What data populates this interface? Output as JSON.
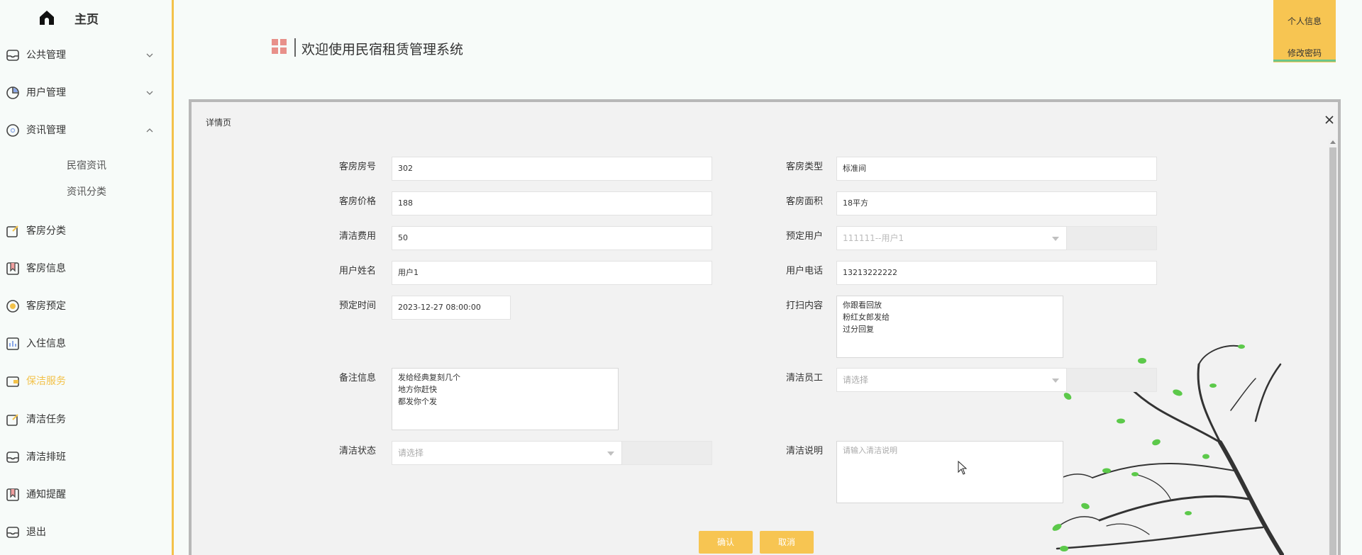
{
  "sidebar": {
    "home_label": "主页",
    "items": [
      {
        "label": "公共管理",
        "icon": "inbox-icon",
        "expandable": true,
        "expanded": false
      },
      {
        "label": "用户管理",
        "icon": "pie-chart-icon",
        "expandable": true,
        "expanded": false
      },
      {
        "label": "资讯管理",
        "icon": "compass-icon",
        "expandable": true,
        "expanded": true
      },
      {
        "label": "客房分类",
        "icon": "edit-icon"
      },
      {
        "label": "客房信息",
        "icon": "bookmark-icon"
      },
      {
        "label": "客房预定",
        "icon": "coin-icon"
      },
      {
        "label": "入住信息",
        "icon": "bar-chart-icon"
      },
      {
        "label": "保洁服务",
        "icon": "wallet-icon",
        "active": true
      },
      {
        "label": "清洁任务",
        "icon": "edit-icon"
      },
      {
        "label": "清洁排班",
        "icon": "inbox-icon"
      },
      {
        "label": "通知提醒",
        "icon": "bookmark-icon"
      },
      {
        "label": "退出",
        "icon": "inbox-icon"
      }
    ],
    "subitems": [
      "民宿资讯",
      "资讯分类"
    ]
  },
  "header": {
    "title": "欢迎使用民宿租赁管理系统",
    "user_info": "个人信息",
    "change_password": "修改密码"
  },
  "dialog": {
    "title": "详情页",
    "fields": {
      "room_no": {
        "label": "客房房号",
        "value": "302"
      },
      "room_type": {
        "label": "客房类型",
        "value": "标准间"
      },
      "room_price": {
        "label": "客房价格",
        "value": "188"
      },
      "room_area": {
        "label": "客房面积",
        "value": "18平方"
      },
      "cleaning_fee": {
        "label": "清洁费用",
        "value": "50"
      },
      "booking_user": {
        "label": "预定用户",
        "value": "111111--用户1"
      },
      "user_name": {
        "label": "用户姓名",
        "value": "用户1"
      },
      "user_phone": {
        "label": "用户电话",
        "value": "13213222222"
      },
      "booking_time": {
        "label": "预定时间",
        "value": "2023-12-27 08:00:00"
      },
      "cleaning_content": {
        "label": "打扫内容",
        "value": "你跟看回放\n粉红女郎发给\n过分回复"
      },
      "remarks": {
        "label": "备注信息",
        "value": "发给经典复刻几个\n地方你赶快\n都发你个发"
      },
      "cleaning_staff": {
        "label": "清洁员工",
        "placeholder": "请选择"
      },
      "cleaning_status": {
        "label": "清洁状态",
        "placeholder": "请选择"
      },
      "cleaning_note": {
        "label": "清洁说明",
        "placeholder": "请输入清洁说明"
      }
    },
    "confirm_label": "确认",
    "cancel_label": "取消"
  },
  "colors": {
    "accent": "#f7c552",
    "sidebar_border": "#f3c24a",
    "active_text": "#f3c24a",
    "leaf": "#5cc94a"
  }
}
